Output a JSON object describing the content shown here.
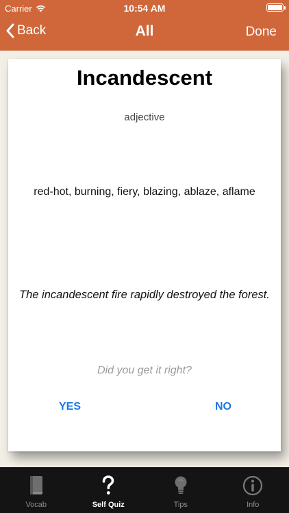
{
  "status": {
    "carrier": "Carrier",
    "time": "10:54 AM"
  },
  "nav": {
    "back_label": "Back",
    "title": "All",
    "done_label": "Done"
  },
  "card": {
    "word": "Incandescent",
    "part_of_speech": "adjective",
    "synonyms": "red-hot, burning, fiery, blazing, ablaze, aflame",
    "example": "The incandescent fire rapidly destroyed the forest.",
    "question": "Did you get it right?",
    "yes_label": "YES",
    "no_label": "NO"
  },
  "tabs": [
    {
      "label": "Vocab",
      "icon": "book-icon"
    },
    {
      "label": "Self Quiz",
      "icon": "question-mark-icon",
      "active": true
    },
    {
      "label": "Tips",
      "icon": "lightbulb-icon"
    },
    {
      "label": "Info",
      "icon": "info-icon"
    }
  ],
  "colors": {
    "header": "#cf673a",
    "tabbar": "#141414",
    "button": "#1878e6"
  }
}
